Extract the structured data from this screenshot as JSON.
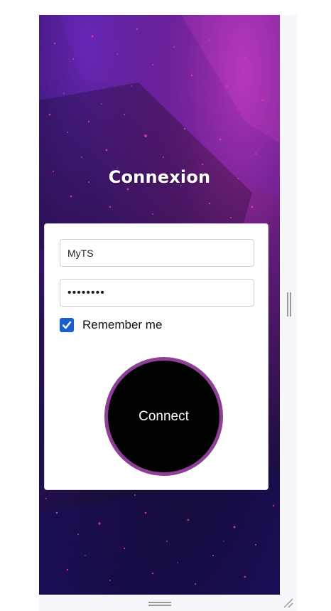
{
  "login": {
    "title": "Connexion",
    "username_value": "MyTS",
    "password_masked": "••••••••",
    "remember_label": "Remember me",
    "remember_checked": true,
    "connect_label": "Connect"
  },
  "colors": {
    "checkbox_accent": "#1a5fd0",
    "connect_border": "#8e3f97",
    "connect_fill": "#000000",
    "background_primary": "#1c0f3c",
    "background_highlight": "#dc3cc8"
  },
  "icons": {
    "checkbox": "checkmark-icon",
    "resize_vertical": "drag-handle-vertical-icon",
    "resize_horizontal": "drag-handle-horizontal-icon",
    "corner": "resize-corner-icon"
  }
}
